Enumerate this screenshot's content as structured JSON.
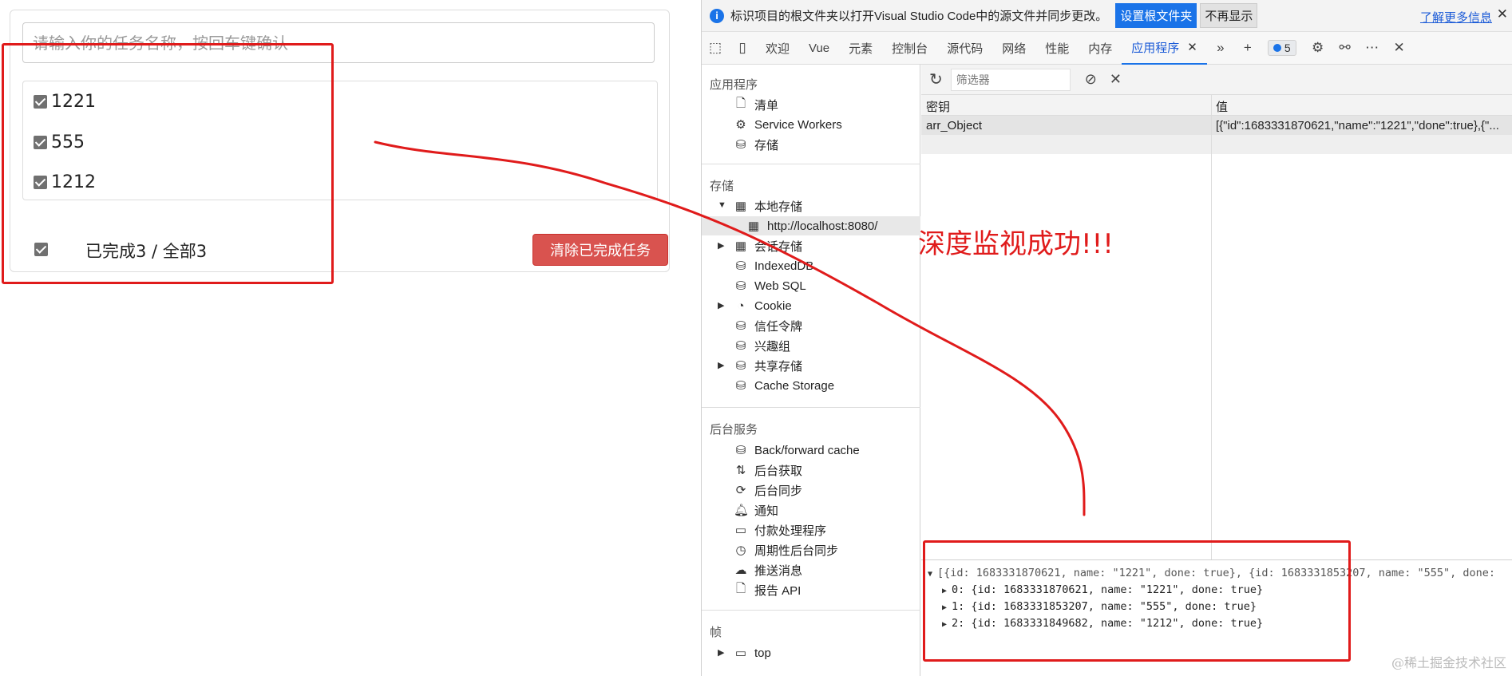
{
  "todo": {
    "input_placeholder": "请输入你的任务名称，按回车键确认",
    "tasks": [
      {
        "name": "1221",
        "done": true
      },
      {
        "name": "555",
        "done": true
      },
      {
        "name": "1212",
        "done": true
      }
    ],
    "footer_stats": "已完成3 / 全部3",
    "clear_button_label": "清除已完成任务"
  },
  "devtools": {
    "info_bar": {
      "message": "标识项目的根文件夹以打开Visual Studio Code中的源文件并同步更改。",
      "set_root_label": "设置根文件夹",
      "dont_show_label": "不再显示",
      "learn_more_label": "了解更多信息"
    },
    "tabs": [
      {
        "label": "欢迎"
      },
      {
        "label": "Vue"
      },
      {
        "label": "元素"
      },
      {
        "label": "控制台"
      },
      {
        "label": "源代码"
      },
      {
        "label": "网络"
      },
      {
        "label": "性能"
      },
      {
        "label": "内存"
      },
      {
        "label": "应用程序",
        "active": true
      }
    ],
    "issues_count": "5",
    "sidebar": {
      "app_section": "应用程序",
      "app_items": [
        "清单",
        "Service Workers",
        "存储"
      ],
      "storage_section": "存储",
      "local_storage": "本地存储",
      "local_storage_origin": "http://localhost:8080/",
      "storage_items": [
        "会话存储",
        "IndexedDB",
        "Web SQL",
        "Cookie",
        "信任令牌",
        "兴趣组",
        "共享存储",
        "Cache Storage"
      ],
      "background_section": "后台服务",
      "background_items": [
        "Back/forward cache",
        "后台获取",
        "后台同步",
        "通知",
        "付款处理程序",
        "周期性后台同步",
        "推送消息",
        "报告 API"
      ],
      "frames_section": "帧",
      "frames_items": [
        "top"
      ]
    },
    "filter_placeholder": "筛选器",
    "table": {
      "key_header": "密钥",
      "value_header": "值",
      "rows": [
        {
          "key": "arr_Object",
          "value": "[{\"id\":1683331870621,\"name\":\"1221\",\"done\":true},{\"..."
        }
      ]
    },
    "console": {
      "summary": "[{id: 1683331870621, name: \"1221\", done: true}, {id: 1683331853207, name: \"555\", done:",
      "items": [
        "0: {id: 1683331870621, name: \"1221\", done: true}",
        "1: {id: 1683331853207, name: \"555\", done: true}",
        "2: {id: 1683331849682, name: \"1212\", done: true}"
      ]
    }
  },
  "annotation": {
    "text": "深度监视成功!!!",
    "color": "#e01b1b"
  },
  "watermark": "@稀土掘金技术社区"
}
